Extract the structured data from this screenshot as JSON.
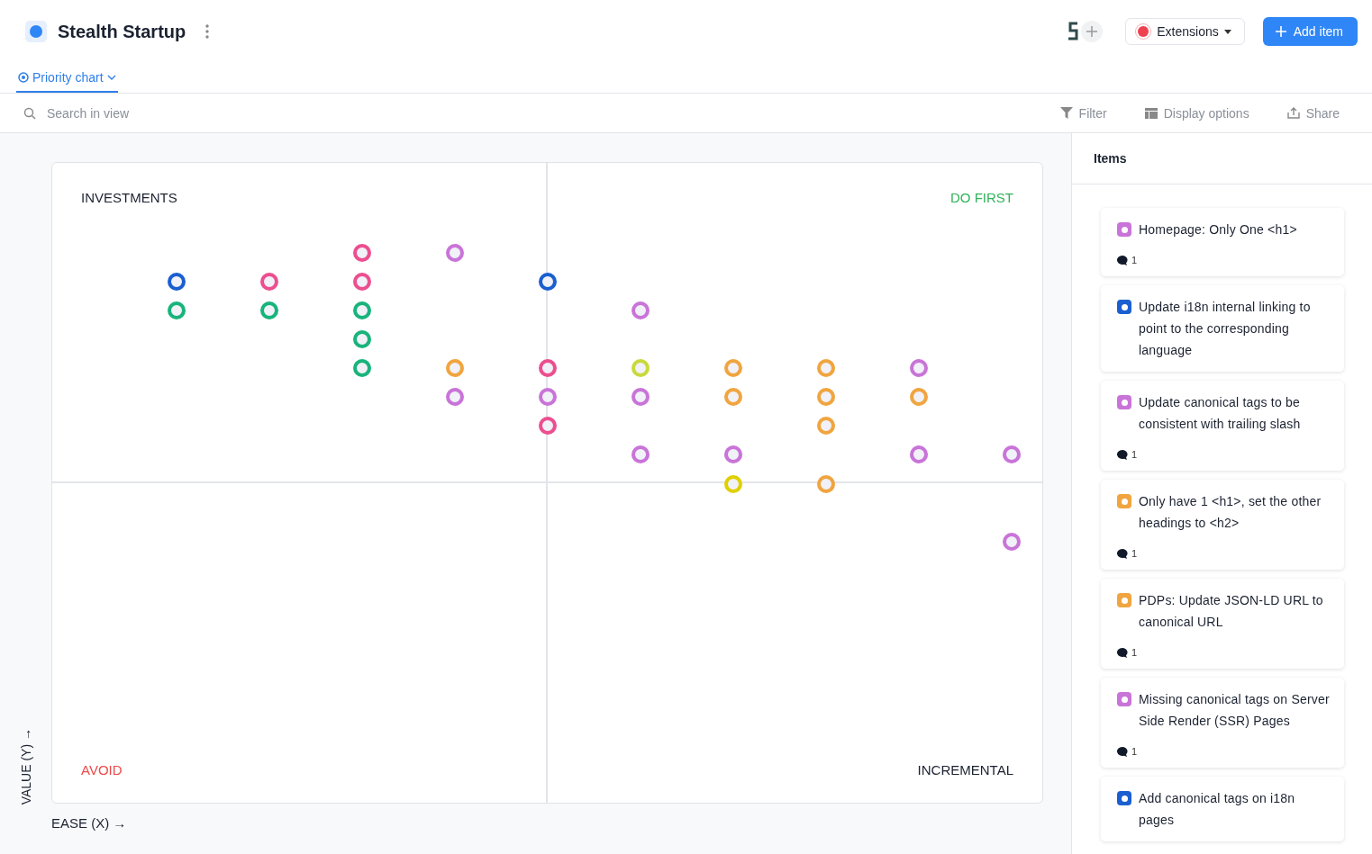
{
  "header": {
    "title": "Stealth Startup",
    "extensions_label": "Extensions",
    "add_button": "Add item"
  },
  "tabs": [
    {
      "label": "Priority chart",
      "selected": true
    }
  ],
  "toolbar": {
    "search_placeholder": "Search in view",
    "actions": [
      "Filter",
      "Display options",
      "Share"
    ]
  },
  "chart": {
    "quadrants": [
      "INVESTMENTS",
      "DO FIRST",
      "AVOID",
      "INCREMENTAL"
    ],
    "x_axis": "EASE (X) →",
    "y_axis": "VALUE (Y) →",
    "points": [
      {
        "color": "#1a5fd0"
      },
      {
        "color": "#18b47b"
      },
      {
        "color": "#ec4f8f"
      },
      {
        "color": "#18b47b"
      },
      {
        "color": "#ec4f8f"
      },
      {
        "color": "#ec4f8f"
      },
      {
        "color": "#18b47b"
      },
      {
        "color": "#18b47b"
      },
      {
        "color": "#18b47b"
      },
      {
        "color": "#c974d8"
      },
      {
        "color": "#f0a540"
      },
      {
        "color": "#c974d8"
      },
      {
        "color": "#1a5fd0"
      },
      {
        "color": "#ec4f8f"
      },
      {
        "color": "#c974d8"
      },
      {
        "color": "#ec4f8f"
      },
      {
        "color": "#c974d8"
      },
      {
        "color": "#c9d93a"
      },
      {
        "color": "#c974d8"
      },
      {
        "color": "#c974d8"
      },
      {
        "color": "#f0a540"
      },
      {
        "color": "#f0a540"
      },
      {
        "color": "#c974d8"
      },
      {
        "color": "#e0d000"
      },
      {
        "color": "#f0a540"
      },
      {
        "color": "#f0a540"
      },
      {
        "color": "#f0a540"
      },
      {
        "color": "#f0a540"
      },
      {
        "color": "#c974d8"
      },
      {
        "color": "#f0a540"
      },
      {
        "color": "#c974d8"
      },
      {
        "color": "#c974d8"
      },
      {
        "color": "#c974d8"
      }
    ]
  },
  "items_panel": {
    "title": "Items",
    "items": [
      {
        "title": "Homepage: Only One <h1>",
        "color": "#c974d8",
        "comments": "1"
      },
      {
        "title": "Update i18n internal linking to point to the corresponding language",
        "color": "#1a5fd0"
      },
      {
        "title": "Update canonical tags to be consistent with trailing slash",
        "color": "#c974d8",
        "comments": "1"
      },
      {
        "title": "Only have 1 <h1>, set the other headings to <h2>",
        "color": "#f0a540",
        "comments": "1"
      },
      {
        "title": "PDPs: Update JSON-LD URL to canonical URL",
        "color": "#f0a540",
        "comments": "1"
      },
      {
        "title": "Missing canonical tags on Server Side Render (SSR) Pages",
        "color": "#c974d8",
        "comments": "1"
      },
      {
        "title": "Add canonical tags on i18n pages",
        "color": "#1a5fd0"
      }
    ]
  }
}
